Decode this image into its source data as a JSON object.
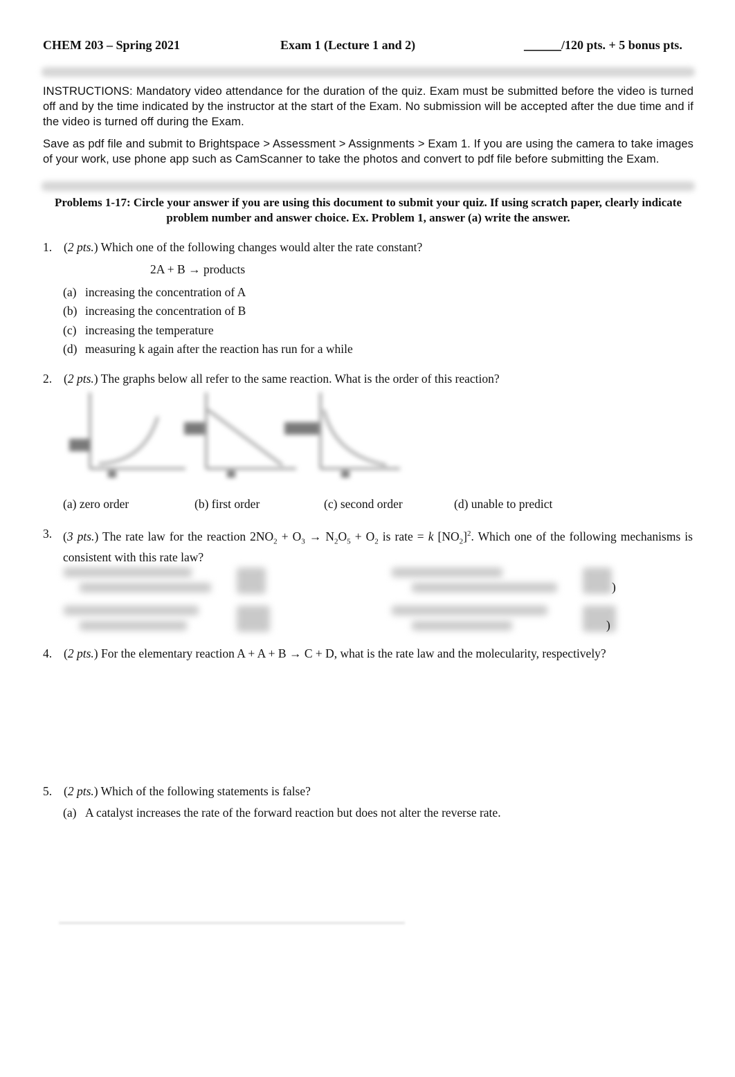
{
  "header": {
    "course": "CHEM 203 – Spring 2021",
    "exam": "Exam 1 (Lecture 1 and 2)",
    "score_blank": "______",
    "score": "/120 pts. + 5 bonus pts."
  },
  "instructions": {
    "paragraph1": "INSTRUCTIONS: Mandatory video attendance for the duration of the quiz. Exam must be submitted before the video is turned off and by the time indicated by the instructor at the start of the Exam. No submission will be accepted after the due time and if the video is turned off during the Exam.",
    "paragraph2": "Save as pdf file and submit to Brightspace > Assessment > Assignments > Exam 1. If you are using the camera to take images of your work, use phone app such as CamScanner to take the photos and convert to pdf file before submitting the Exam."
  },
  "directions": "Problems 1-17: Circle your answer if you are using this document to submit your quiz. If using scratch paper, clearly indicate problem number and answer choice. Ex. Problem 1, answer (a) write the answer.",
  "questions": [
    {
      "number": "1.",
      "points": "2 pts.",
      "text": "Which one of the following changes would alter the rate constant?",
      "equation": "2A + B → products",
      "options": [
        {
          "label": "(a)",
          "text": "increasing the concentration of A"
        },
        {
          "label": "(b)",
          "text": "increasing the concentration of B"
        },
        {
          "label": "(c)",
          "text": "increasing the temperature"
        },
        {
          "label": "(d)",
          "text": "measuring k again after the reaction has run for a while"
        }
      ]
    },
    {
      "number": "2.",
      "points": "2 pts.",
      "text": "The graphs below all refer to the same reaction.  What is the order of this reaction?",
      "options": [
        {
          "label": "(a)",
          "text": "zero order"
        },
        {
          "label": "(b)",
          "text": "first order"
        },
        {
          "label": "(c)",
          "text": "second order"
        },
        {
          "label": "(d)",
          "text": "unable to predict"
        }
      ]
    },
    {
      "number": "3.",
      "points": "3 pts.",
      "text_pre": "The rate law for the reaction 2NO",
      "text_mid1": " + O",
      "text_mid2": " → N",
      "text_mid3": "O",
      "text_mid4": " + O",
      "text_mid5": " is rate = ",
      "k": "k",
      "text_mid6": " [NO",
      "text_mid7": "]",
      "exp": "2",
      "text_post": ". Which one of the following mechanisms is consistent with this rate law?",
      "sub2": "2",
      "sub3": "3",
      "sub5": "5",
      "paren": ")"
    },
    {
      "number": "4.",
      "points": "2 pts.",
      "text": "For the elementary reaction A + A + B → C + D, what is the rate law and the molecularity, respectively?"
    },
    {
      "number": "5.",
      "points": "2 pts.",
      "text": "Which of the following statements is false?",
      "options": [
        {
          "label": "(a)",
          "text": "A catalyst increases the rate of the forward reaction but does not alter the reverse rate."
        }
      ]
    }
  ]
}
